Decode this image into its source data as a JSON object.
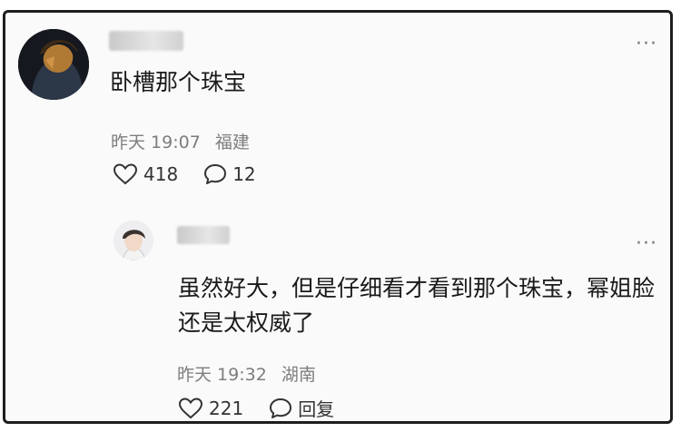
{
  "comment": {
    "text": "卧槽那个珠宝",
    "time": "昨天 19:07",
    "location": "福建",
    "likes": "418",
    "replies": "12",
    "more": "···"
  },
  "reply": {
    "text": "虽然好大，但是仔细看才看到那个珠宝，幂姐脸还是太权威了",
    "time": "昨天 19:32",
    "location": "湖南",
    "likes": "221",
    "reply_label": "回复",
    "more": "···"
  },
  "icons": {
    "like": "heart-outline-icon",
    "comment": "speech-bubble-icon",
    "more": "more-dots-icon"
  },
  "colors": {
    "text": "#1a1a1a",
    "meta": "#7d7d7d",
    "frame": "#1e1e1e",
    "background": "#fafafa"
  }
}
